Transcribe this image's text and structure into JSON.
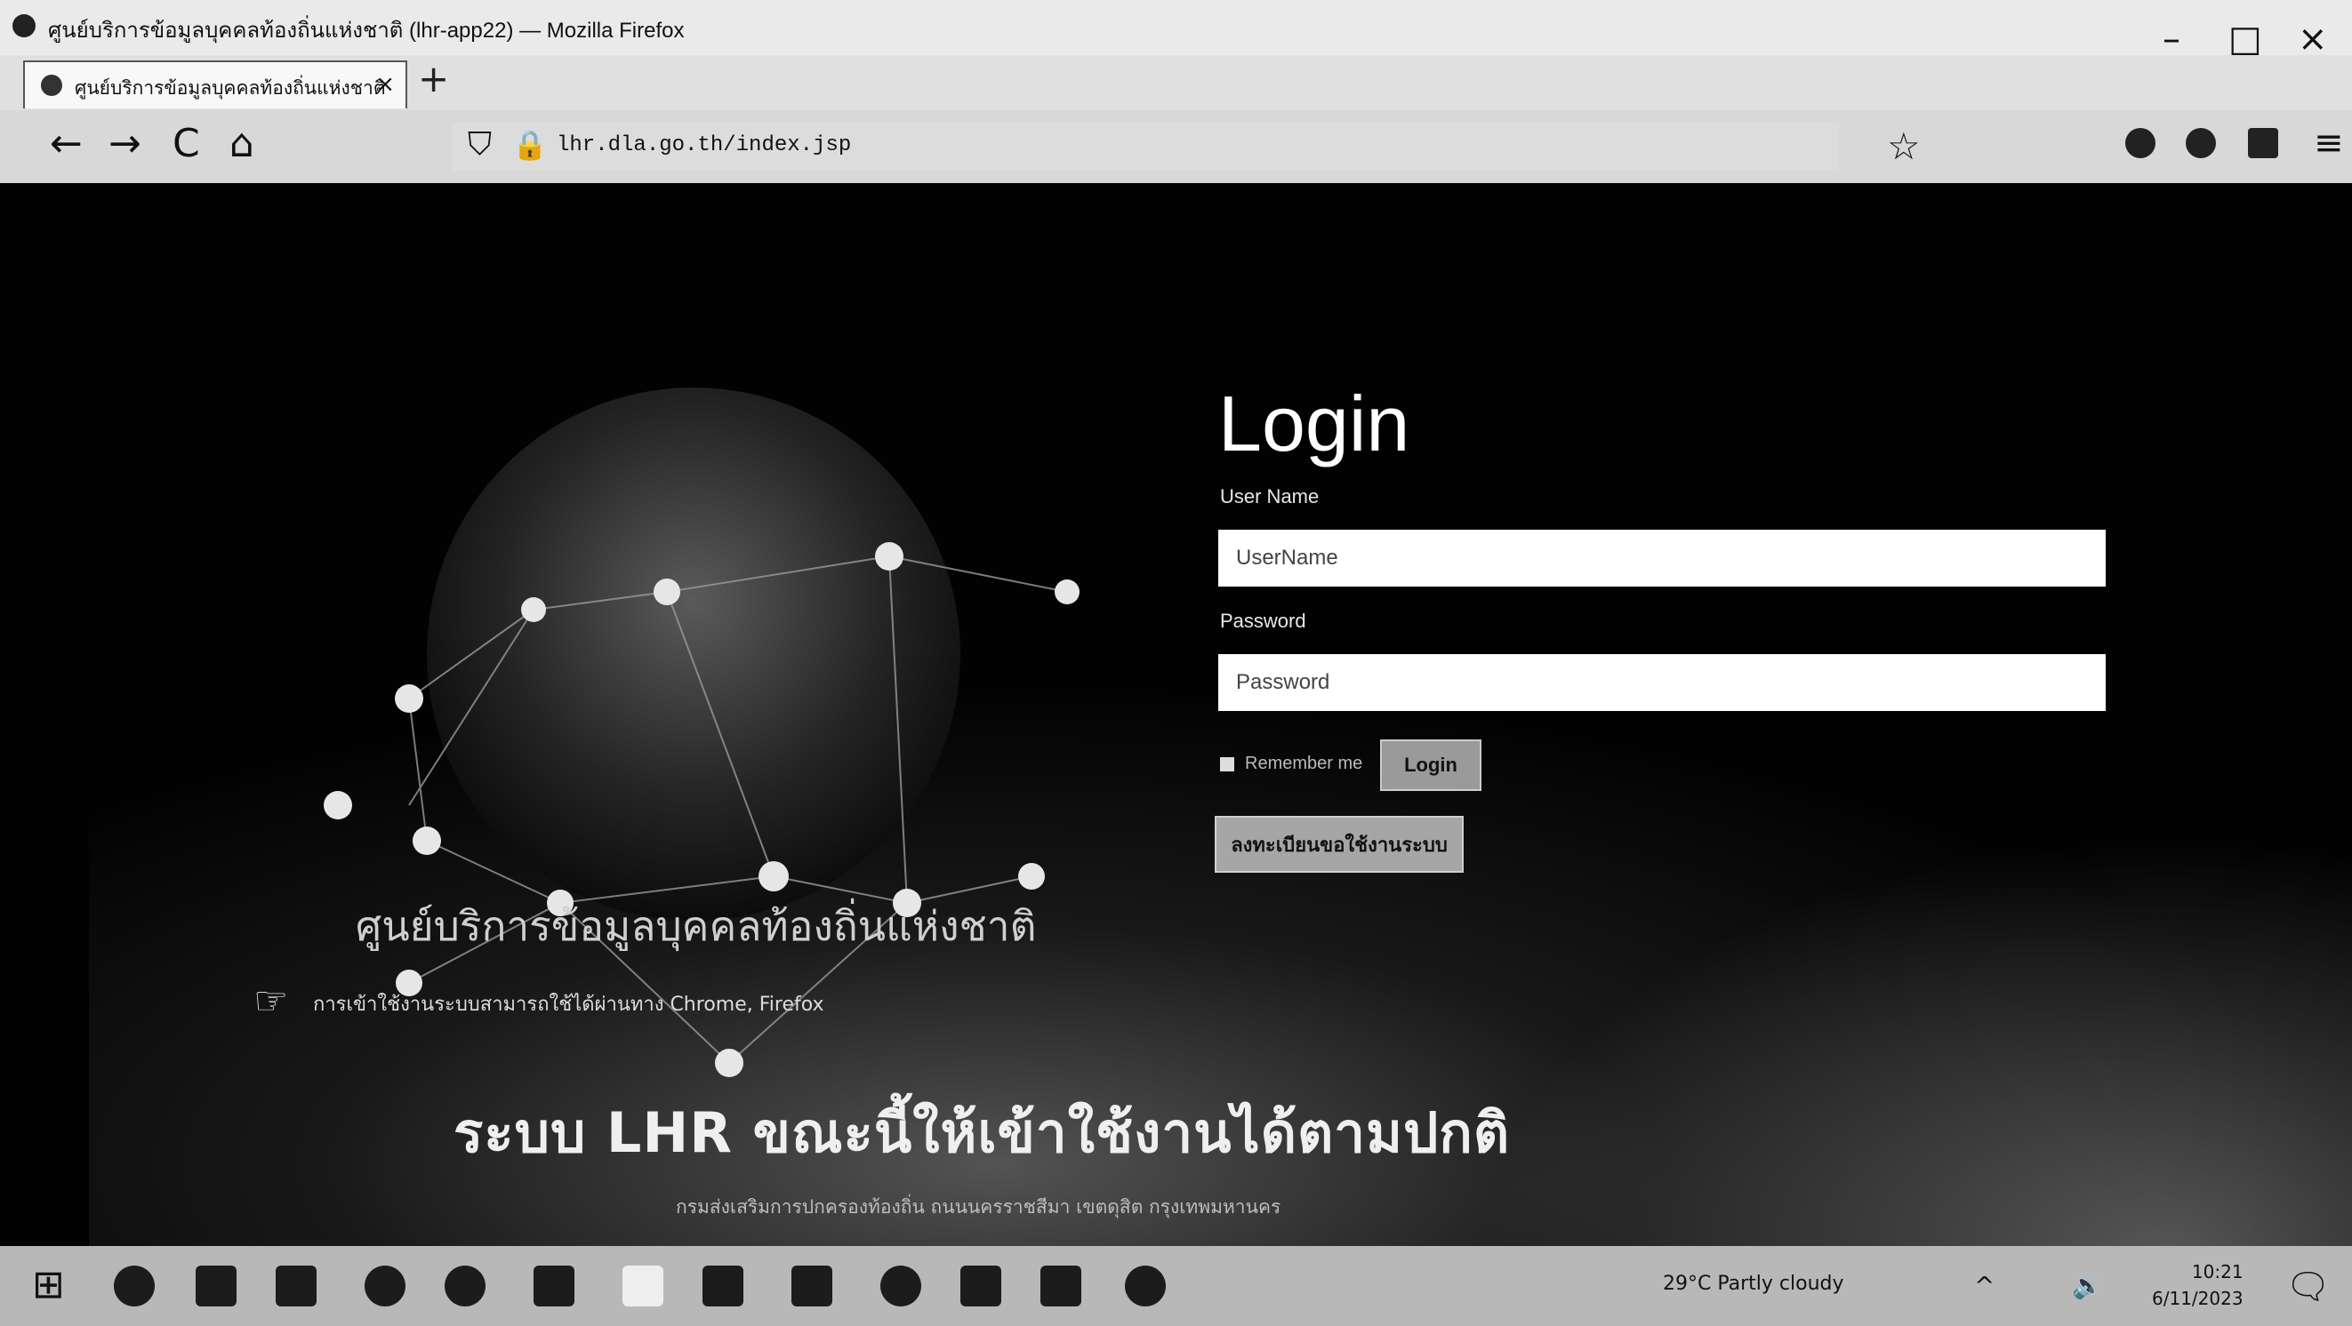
{
  "window": {
    "title": "ศูนย์บริการข้อมูลบุคคลท้องถิ่นแห่งชาติ (lhr-app22) — Mozilla Firefox",
    "minimize": "–",
    "maximize": "□",
    "close": "×"
  },
  "tab": {
    "title": "ศูนย์บริการข้อมูลบุคคลท้องถิ่นแห่งชาติ",
    "close": "×",
    "new_tab": "+"
  },
  "nav": {
    "back": "←",
    "forward": "→",
    "reload": "C",
    "home": "⌂",
    "url": "lhr.dla.go.th/index.jsp",
    "bookmark_star": "☆",
    "menu": "≡"
  },
  "page": {
    "brand_text": "ศูนย์บริการข้อมูลบุคคลท้องถิ่นแห่งชาติ",
    "notice_text": "การเข้าใช้งานระบบสามารถใช้ได้ผ่านทาง Chrome, Firefox",
    "marquee_text": "ระบบ LHR ขณะนี้ให้เข้าใช้งานได้ตามปกติ",
    "footer_text": "กรมส่งเสริมการปกครองท้องถิ่น ถนนนครราชสีมา เขตดุสิต กรุงเทพมหานคร"
  },
  "login": {
    "title": "Login",
    "username_label": "User Name",
    "username_placeholder": "UserName",
    "password_label": "Password",
    "password_placeholder": "Password",
    "remember_label": "Remember me",
    "login_button": "Login",
    "register_button": "ลงทะเบียนขอใช้งานระบบ"
  },
  "taskbar": {
    "start": "⊞",
    "weather": "29°C Partly cloudy",
    "tray_icons": [
      "^",
      "🔊"
    ],
    "time": "10:21",
    "date": "6/11/2023",
    "notify": "🗨"
  },
  "colors": {
    "page_bg": "#020202",
    "login_title": "#ffffff",
    "button_bg": "#9a9a9a"
  }
}
